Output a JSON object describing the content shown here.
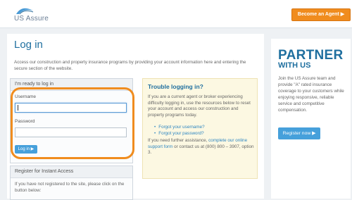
{
  "header": {
    "logo_text": "US Assure",
    "agent_button": "Become an Agent ▶"
  },
  "main": {
    "title": "Log in",
    "intro": "Access our construction and property insurance programs by providing your account information here and entering the secure section of the website."
  },
  "login": {
    "heading": "I'm ready to log in",
    "username_label": "Username",
    "username_value": "",
    "password_label": "Password",
    "password_value": "",
    "button": "Log in ▶"
  },
  "register": {
    "heading": "Register for Instant Access",
    "text": "If you have not registered to the site, please click on the button below:"
  },
  "trouble": {
    "title": "Trouble logging in?",
    "text": "If you are a current agent or broker experiencing difficulty logging in, use the resources below to reset your account and access our construction and property programs today.",
    "links": [
      "Forgot your username?",
      "Forgot your password?"
    ],
    "more_prefix": "If you need further assistance, ",
    "more_link": "complete our online support form",
    "more_suffix": " or contact us at (800) 800 – 3907, option 3."
  },
  "partner": {
    "title": "PARTNER",
    "subtitle": "WITH US",
    "text": "Join the US Assure team and provide \"A\" rated insurance coverage to your customers while enjoying responsive, reliable service and competitive compensation.",
    "button": "Register now ▶"
  },
  "colors": {
    "accent": "#f08c1e",
    "brand_blue": "#1f6f9f",
    "button_blue": "#46a0db",
    "link_blue": "#2e86c1"
  }
}
